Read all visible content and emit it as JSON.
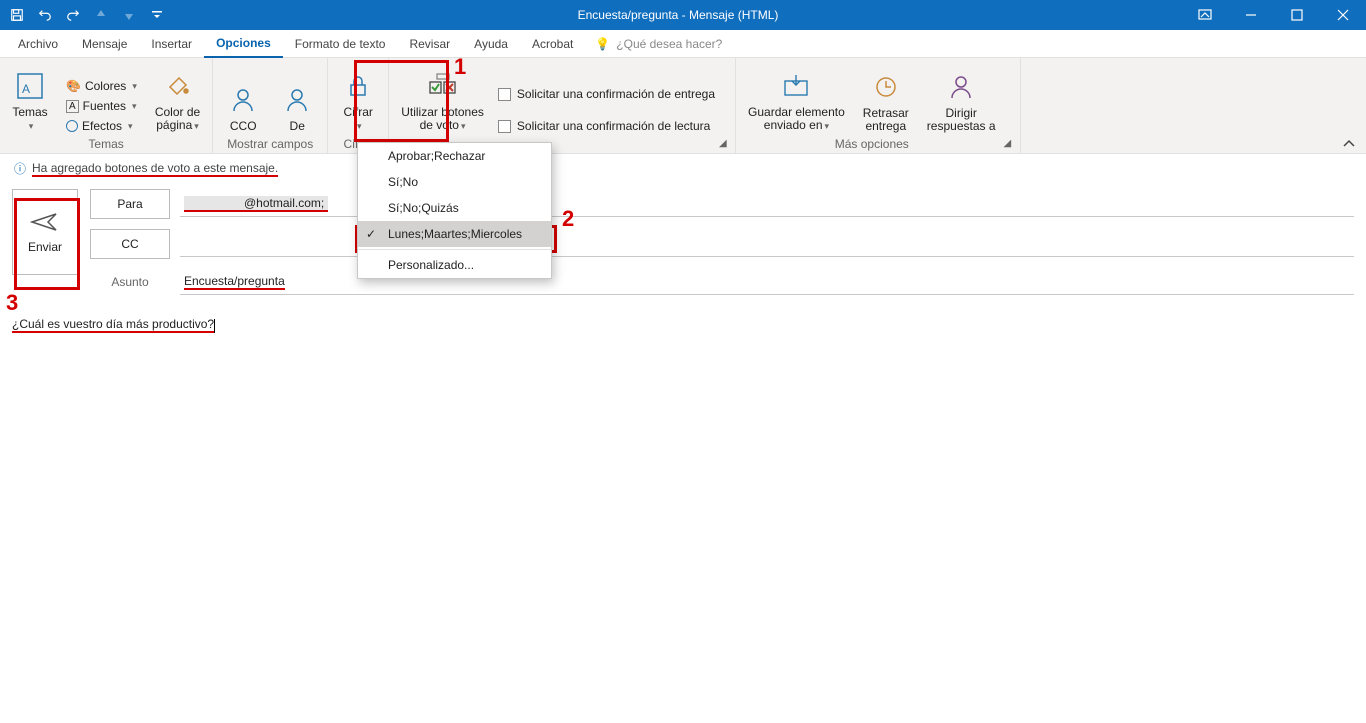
{
  "titlebar": {
    "title": "Encuesta/pregunta  -  Mensaje (HTML)"
  },
  "tabs": {
    "archivo": "Archivo",
    "mensaje": "Mensaje",
    "insertar": "Insertar",
    "opciones": "Opciones",
    "formato": "Formato de texto",
    "revisar": "Revisar",
    "ayuda": "Ayuda",
    "acrobat": "Acrobat",
    "tellme": "¿Qué desea hacer?"
  },
  "ribbon": {
    "temas": {
      "label_group": "Temas",
      "temas": "Temas",
      "colores": "Colores",
      "fuentes": "Fuentes",
      "efectos": "Efectos",
      "color_pagina": "Color de",
      "color_pagina2": "página"
    },
    "campos": {
      "label_group": "Mostrar campos",
      "cco": "CCO",
      "de": "De"
    },
    "cifrar": {
      "label_group": "Cifrar",
      "cifrar": "Cifrar"
    },
    "seguimiento": {
      "voting": "Utilizar botones",
      "voting2": "de voto",
      "delivery": "Solicitar una confirmación de entrega",
      "read": "Solicitar una confirmación de lectura"
    },
    "mas": {
      "label_group": "Más opciones",
      "guardar": "Guardar elemento",
      "guardar2": "enviado en",
      "retrasar": "Retrasar",
      "retrasar2": "entrega",
      "dirigir": "Dirigir",
      "dirigir2": "respuestas a"
    }
  },
  "dropdown": {
    "opt1": "Aprobar;Rechazar",
    "opt2": "Sí;No",
    "opt3": "Sí;No;Quizás",
    "opt4": "Lunes;Maartes;Miercoles",
    "custom": "Personalizado..."
  },
  "infobanner": "Ha agregado botones de voto a este mensaje.",
  "compose": {
    "send": "Enviar",
    "para": "Para",
    "cc": "CC",
    "asunto_lbl": "Asunto",
    "to_value": "@hotmail.com;",
    "subject": "Encuesta/pregunta",
    "body": "¿Cuál es vuestro día más productivo?"
  },
  "annotations": {
    "n1": "1",
    "n2": "2",
    "n3": "3"
  }
}
